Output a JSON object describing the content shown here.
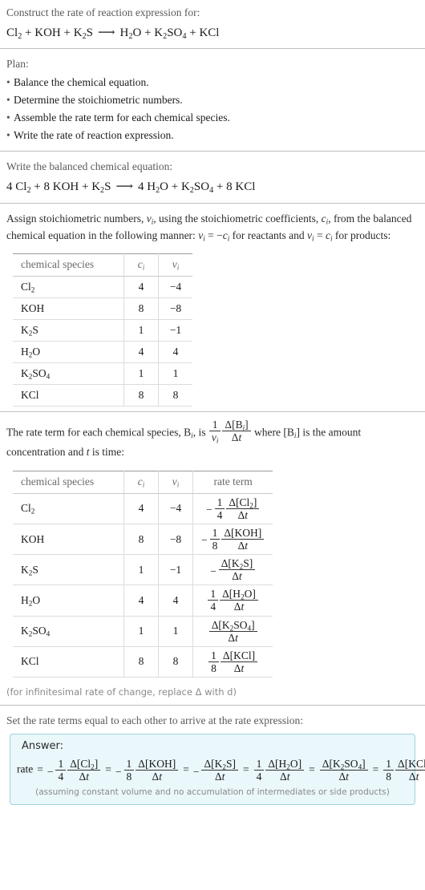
{
  "header": {
    "prompt": "Construct the rate of reaction expression for:",
    "equation": {
      "reactants": [
        "Cl_2",
        "KOH",
        "K_2S"
      ],
      "products": [
        "H_2O",
        "K_2SO_4",
        "KCl"
      ],
      "arrow": "⟶"
    }
  },
  "plan": {
    "label": "Plan:",
    "items": [
      "Balance the chemical equation.",
      "Determine the stoichiometric numbers.",
      "Assemble the rate term for each chemical species.",
      "Write the rate of reaction expression."
    ]
  },
  "balanced": {
    "label": "Write the balanced chemical equation:",
    "reactants": [
      {
        "coeff": "4",
        "formula": "Cl_2"
      },
      {
        "coeff": "8",
        "formula": "KOH"
      },
      {
        "coeff": "",
        "formula": "K_2S"
      }
    ],
    "products": [
      {
        "coeff": "4",
        "formula": "H_2O"
      },
      {
        "coeff": "",
        "formula": "K_2SO_4"
      },
      {
        "coeff": "8",
        "formula": "KCl"
      }
    ],
    "arrow": "⟶"
  },
  "assign": {
    "paragraph_1": "Assign stoichiometric numbers, ",
    "sym_nu": "ν",
    "paragraph_2": ", using the stoichiometric coefficients, ",
    "sym_c": "c",
    "paragraph_3": ", from the balanced chemical equation in the following manner: ",
    "rule_reactants": " = −",
    "paragraph_4": " for reactants and ",
    "rule_products": " = ",
    "paragraph_5": " for products:"
  },
  "table_stoich": {
    "headers": [
      "chemical species",
      "c",
      "ν"
    ],
    "header_sub": "i",
    "rows": [
      {
        "species": "Cl_2",
        "c": "4",
        "nu": "−4"
      },
      {
        "species": "KOH",
        "c": "8",
        "nu": "−8"
      },
      {
        "species": "K_2S",
        "c": "1",
        "nu": "−1"
      },
      {
        "species": "H_2O",
        "c": "4",
        "nu": "4"
      },
      {
        "species": "K_2SO_4",
        "c": "1",
        "nu": "1"
      },
      {
        "species": "KCl",
        "c": "8",
        "nu": "8"
      }
    ]
  },
  "rate_intro": {
    "part_1": "The rate term for each chemical species, B",
    "sub_i": "i",
    "part_2": ", is ",
    "frac_num": "1",
    "frac_den": "ν",
    "delta_num": "Δ[B",
    "delta_den": "Δt",
    "part_3": " where [B",
    "part_4": "] is the amount concentration and ",
    "part_5": " is time:"
  },
  "table_rate": {
    "headers": [
      "chemical species",
      "c",
      "ν",
      "rate term"
    ],
    "header_sub": "i",
    "rows": [
      {
        "species": "Cl_2",
        "c": "4",
        "nu": "−4",
        "sign": "−",
        "coeff_num": "1",
        "coeff_den": "4",
        "delta_num": "Δ[Cl_2]",
        "delta_den": "Δt"
      },
      {
        "species": "KOH",
        "c": "8",
        "nu": "−8",
        "sign": "−",
        "coeff_num": "1",
        "coeff_den": "8",
        "delta_num": "Δ[KOH]",
        "delta_den": "Δt"
      },
      {
        "species": "K_2S",
        "c": "1",
        "nu": "−1",
        "sign": "−",
        "coeff_num": "",
        "coeff_den": "",
        "delta_num": "Δ[K_2S]",
        "delta_den": "Δt"
      },
      {
        "species": "H_2O",
        "c": "4",
        "nu": "4",
        "sign": "",
        "coeff_num": "1",
        "coeff_den": "4",
        "delta_num": "Δ[H_2O]",
        "delta_den": "Δt"
      },
      {
        "species": "K_2SO_4",
        "c": "1",
        "nu": "1",
        "sign": "",
        "coeff_num": "",
        "coeff_den": "",
        "delta_num": "Δ[K_2SO_4]",
        "delta_den": "Δt"
      },
      {
        "species": "KCl",
        "c": "8",
        "nu": "8",
        "sign": "",
        "coeff_num": "1",
        "coeff_den": "8",
        "delta_num": "Δ[KCl]",
        "delta_den": "Δt"
      }
    ],
    "footnote": "(for infinitesimal rate of change, replace Δ with d)"
  },
  "final": {
    "label": "Set the rate terms equal to each other to arrive at the rate expression:",
    "answer_label": "Answer:",
    "rate_word": "rate",
    "equals": "=",
    "terms": [
      {
        "sign": "−",
        "coeff_num": "1",
        "coeff_den": "4",
        "delta_num": "Δ[Cl_2]",
        "delta_den": "Δt"
      },
      {
        "sign": "−",
        "coeff_num": "1",
        "coeff_den": "8",
        "delta_num": "Δ[KOH]",
        "delta_den": "Δt"
      },
      {
        "sign": "−",
        "coeff_num": "",
        "coeff_den": "",
        "delta_num": "Δ[K_2S]",
        "delta_den": "Δt"
      },
      {
        "sign": "",
        "coeff_num": "1",
        "coeff_den": "4",
        "delta_num": "Δ[H_2O]",
        "delta_den": "Δt"
      },
      {
        "sign": "",
        "coeff_num": "",
        "coeff_den": "",
        "delta_num": "Δ[K_2SO_4]",
        "delta_den": "Δt"
      },
      {
        "sign": "",
        "coeff_num": "1",
        "coeff_den": "8",
        "delta_num": "Δ[KCl]",
        "delta_den": "Δt"
      }
    ],
    "note": "(assuming constant volume and no accumulation of intermediates or side products)"
  }
}
